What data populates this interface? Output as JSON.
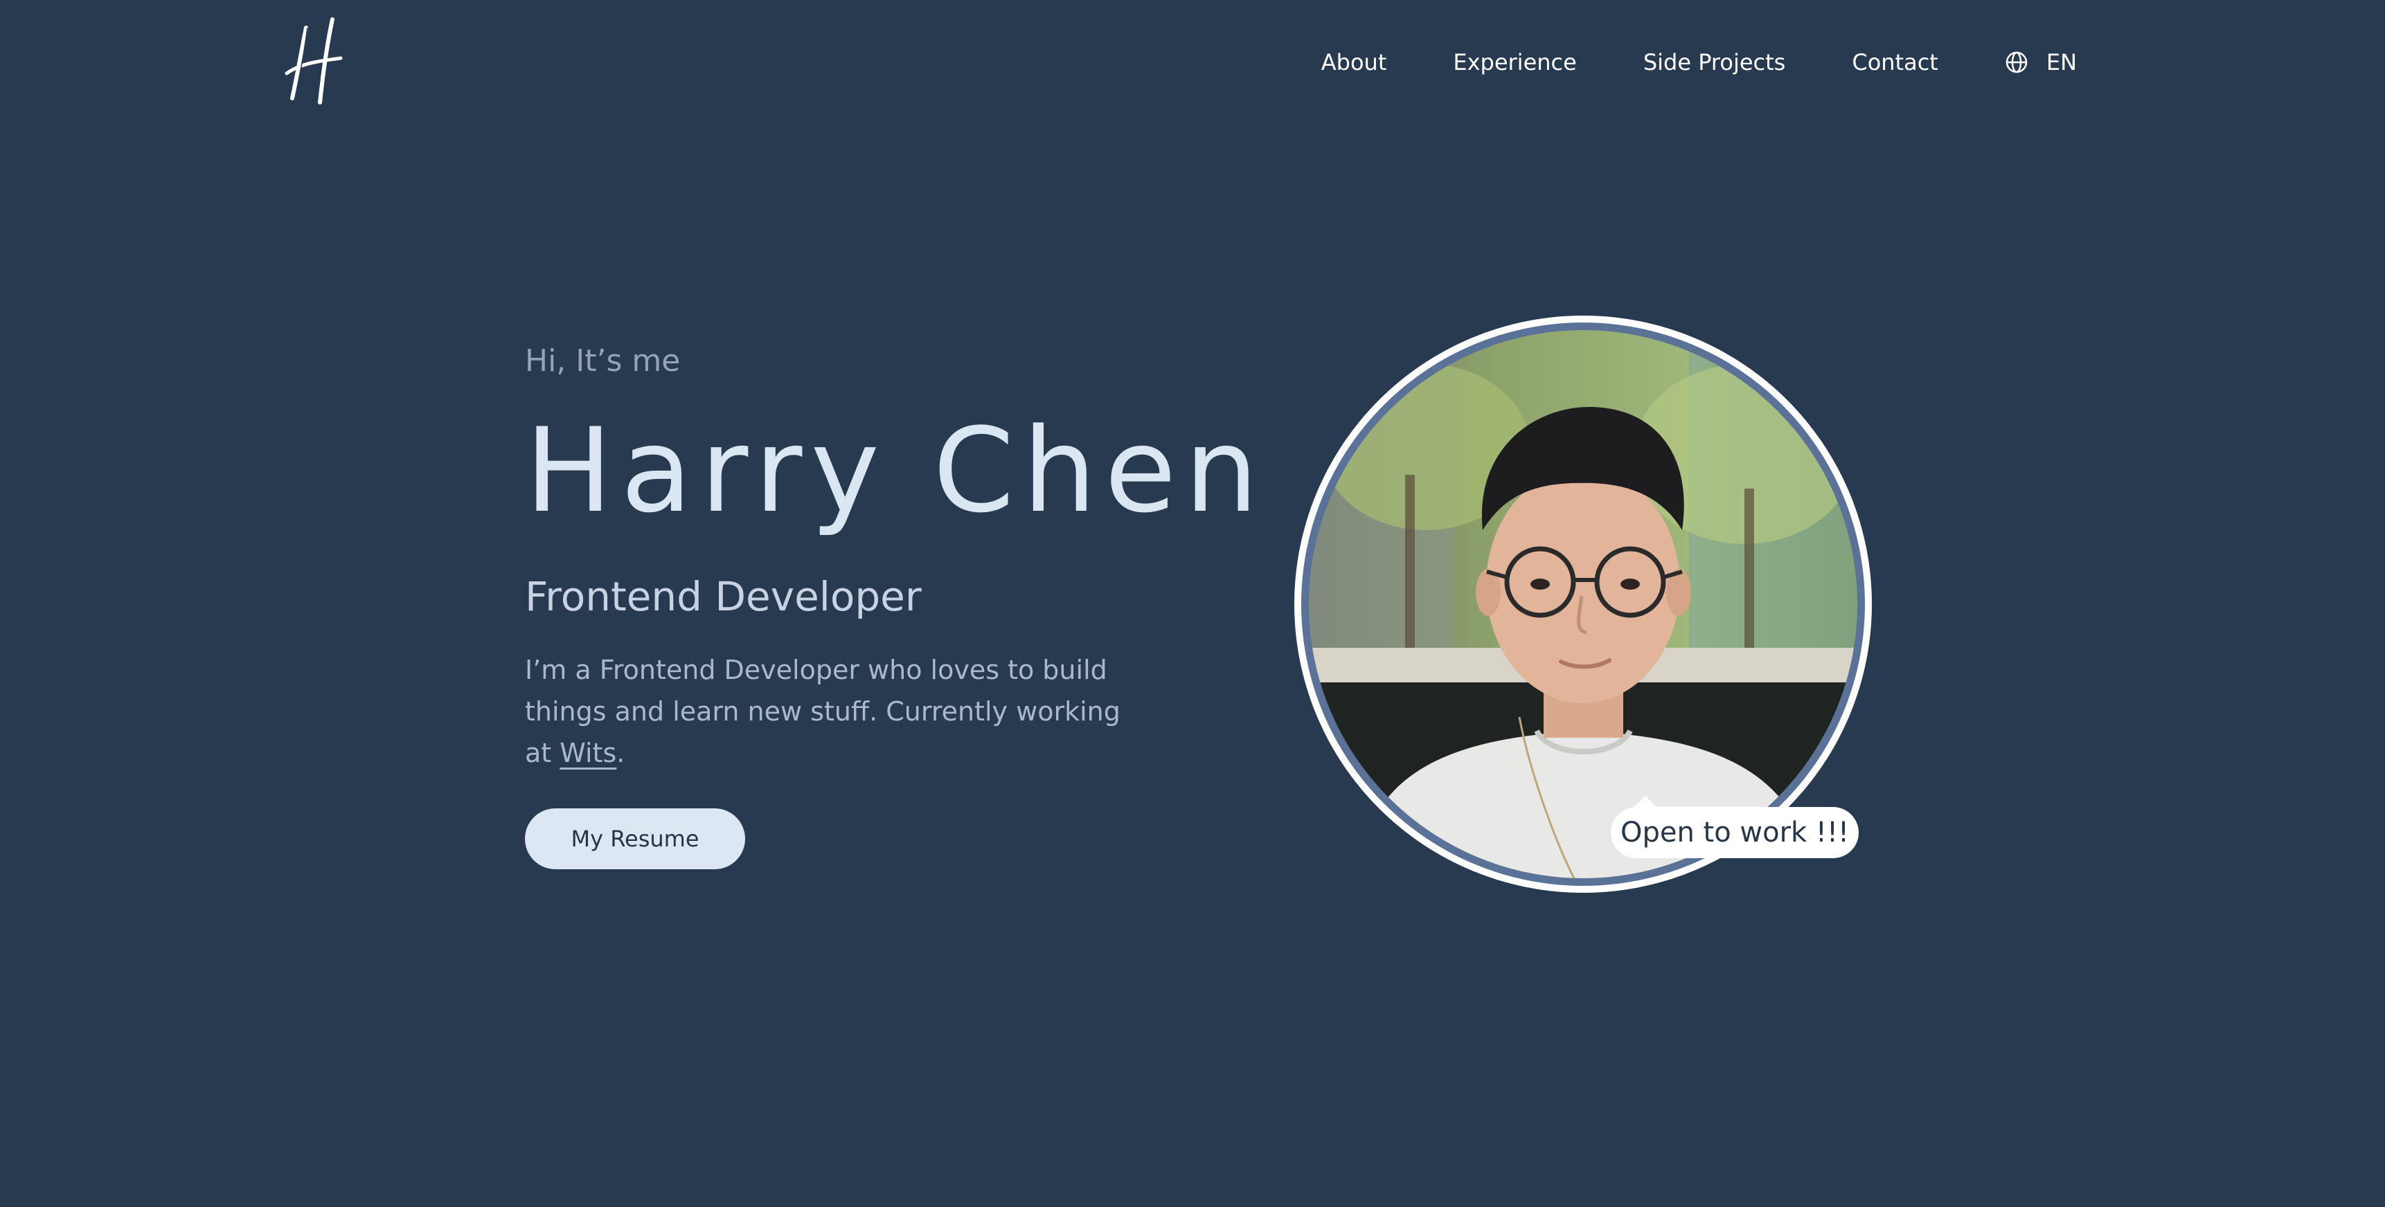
{
  "header": {
    "logo_icon": "handwritten-h-logo",
    "nav": [
      "About",
      "Experience",
      "Side Projects",
      "Contact"
    ],
    "language": {
      "icon": "globe-icon",
      "label": "EN"
    }
  },
  "hero": {
    "greeting": "Hi, It’s me",
    "name": "Harry Chen",
    "role": "Frontend Developer",
    "bio_before": "I’m a Frontend Developer who loves to build things and learn new stuff. Currently working at ",
    "bio_link": "Wits",
    "bio_after": ".",
    "resume_button": "My Resume",
    "badge": "Open to work !!!"
  },
  "colors": {
    "background": "#283a4f",
    "heading": "#dbe6f3",
    "button_bg": "#dde7f4",
    "button_text": "#263649"
  }
}
